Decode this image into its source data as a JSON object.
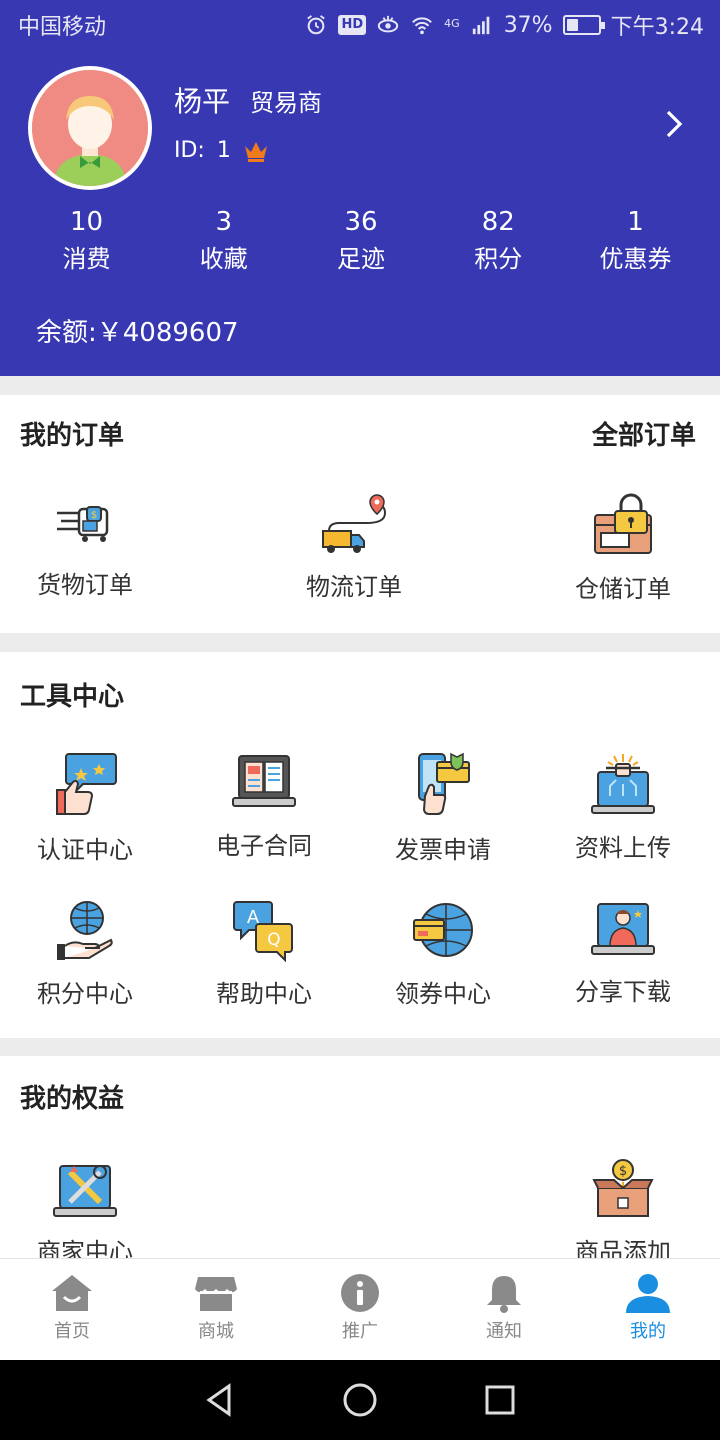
{
  "status_bar": {
    "carrier": "中国移动",
    "network": "4G",
    "battery_percent": "37%",
    "battery_level": 0.37,
    "time": "下午3:24",
    "icons": [
      "alarm-icon",
      "hd-icon",
      "eye-icon",
      "wifi-icon",
      "signal-icon",
      "battery-icon"
    ]
  },
  "profile": {
    "name": "杨平",
    "role": "贸易商",
    "id_label": "ID:",
    "id_value": "1",
    "badge_icon": "crown-icon"
  },
  "stats": [
    {
      "value": "10",
      "label": "消费"
    },
    {
      "value": "3",
      "label": "收藏"
    },
    {
      "value": "36",
      "label": "足迹"
    },
    {
      "value": "82",
      "label": "积分"
    },
    {
      "value": "1",
      "label": "优惠券"
    }
  ],
  "balance": {
    "label": "余额:",
    "value": "￥4089607"
  },
  "orders": {
    "title": "我的订单",
    "all_link": "全部订单",
    "items": [
      {
        "label": "货物订单",
        "icon": "cargo-order-icon"
      },
      {
        "label": "物流订单",
        "icon": "logistics-truck-icon"
      },
      {
        "label": "仓储订单",
        "icon": "storage-lock-icon"
      }
    ]
  },
  "tools": {
    "title": "工具中心",
    "items": [
      {
        "label": "认证中心",
        "icon": "thumbs-up-rating-icon"
      },
      {
        "label": "电子合同",
        "icon": "ebook-laptop-icon"
      },
      {
        "label": "发票申请",
        "icon": "phone-card-icon"
      },
      {
        "label": "资料上传",
        "icon": "laptop-upload-icon"
      },
      {
        "label": "积分中心",
        "icon": "globe-hand-icon"
      },
      {
        "label": "帮助中心",
        "icon": "qa-chat-icon"
      },
      {
        "label": "领券中心",
        "icon": "globe-card-icon"
      },
      {
        "label": "分享下载",
        "icon": "laptop-person-icon"
      }
    ]
  },
  "rights": {
    "title": "我的权益",
    "items": [
      {
        "label": "商家中心",
        "icon": "laptop-tools-icon"
      },
      {
        "label": "商品添加",
        "icon": "box-coin-icon"
      }
    ]
  },
  "tabbar": {
    "items": [
      {
        "label": "首页",
        "icon": "home-icon"
      },
      {
        "label": "商城",
        "icon": "store-icon"
      },
      {
        "label": "推广",
        "icon": "info-icon"
      },
      {
        "label": "通知",
        "icon": "bell-icon"
      },
      {
        "label": "我的",
        "icon": "user-icon"
      }
    ],
    "active_index": 4,
    "active_color": "#1a8ee0",
    "inactive_color": "#888888"
  },
  "colors": {
    "header_bg": "#3838b3",
    "page_bg": "#ececec",
    "card_bg": "#ffffff"
  }
}
